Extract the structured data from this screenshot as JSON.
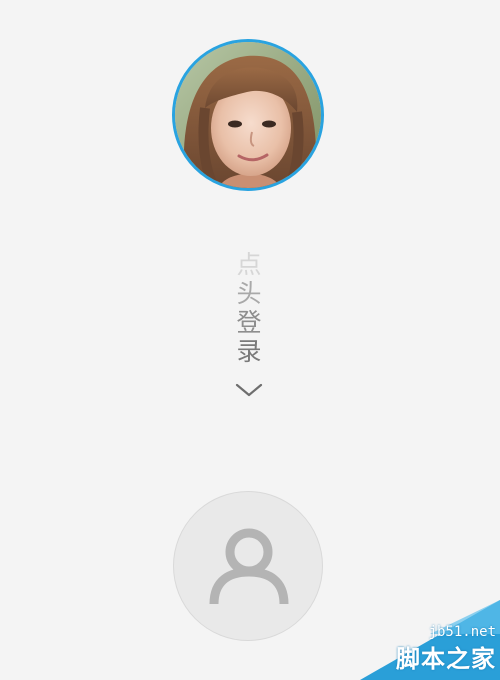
{
  "login": {
    "instruction_chars": [
      "点",
      "头",
      "登",
      "录"
    ]
  },
  "icons": {
    "chevron": "chevron-down-icon",
    "user": "user-icon"
  },
  "colors": {
    "background": "#f4f4f4",
    "avatar_ring": "#29a3e0",
    "watermark_blue": "#2a9fd8"
  },
  "watermark": {
    "domain": "jb51.net",
    "brand": "脚本之家"
  }
}
